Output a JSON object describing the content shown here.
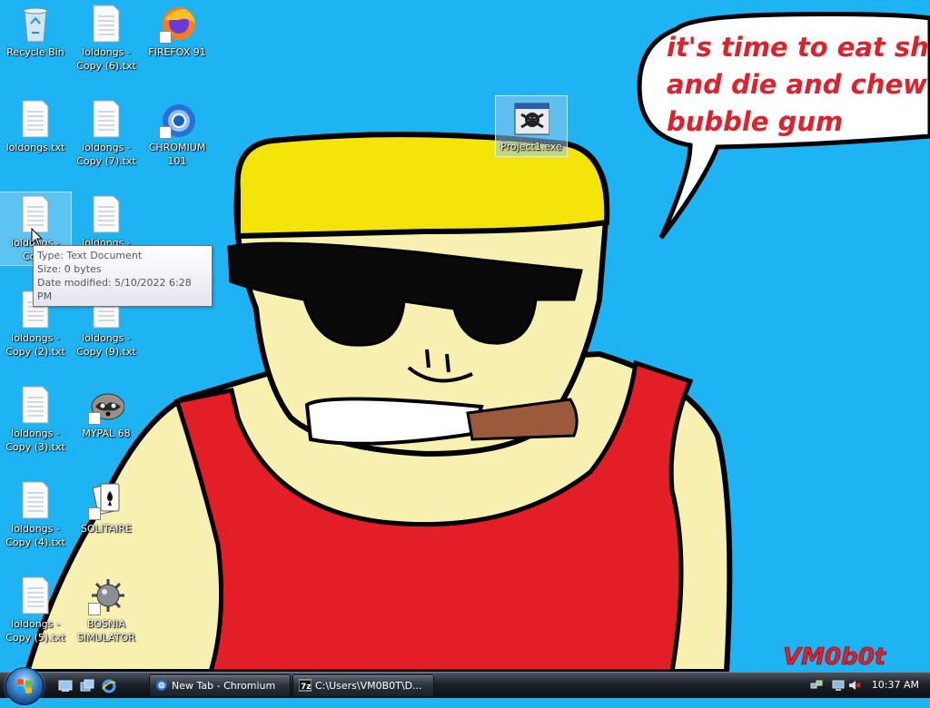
{
  "wallpaper": {
    "speech_line1": "it's time to eat shit",
    "speech_line2": "and die and chew",
    "speech_line3": "bubble gum",
    "signature": "VM0b0t",
    "colors": {
      "sky": "#1eb3f2",
      "text_red": "#e0202a",
      "hat": "#f4e40a",
      "shirt": "#e41e26",
      "skin": "#f7f0b0"
    }
  },
  "desktop_icons": [
    {
      "label": "Recycle Bin",
      "icon": "recycle-bin-icon"
    },
    {
      "label": "loldongs - Copy (6).txt",
      "icon": "text-file-icon"
    },
    {
      "label": "FIREFOX 91",
      "icon": "firefox-icon"
    },
    {
      "label": "loldongs.txt",
      "icon": "text-file-icon"
    },
    {
      "label": "loldongs - Copy (7).txt",
      "icon": "text-file-icon"
    },
    {
      "label": "CHROMIUM 101",
      "icon": "chromium-icon"
    },
    {
      "label": "loldongs - Copy",
      "icon": "text-file-icon"
    },
    {
      "label": "loldongs -",
      "icon": "text-file-icon"
    },
    {
      "label": "loldongs - Copy (2).txt",
      "icon": "text-file-icon"
    },
    {
      "label": "loldongs - Copy (9).txt",
      "icon": "text-file-icon"
    },
    {
      "label": "loldongs - Copy (3).txt",
      "icon": "text-file-icon"
    },
    {
      "label": "MYPAL 68",
      "icon": "raccoon-icon"
    },
    {
      "label": "loldongs - Copy (4).txt",
      "icon": "text-file-icon"
    },
    {
      "label": "SOLITAIRE",
      "icon": "solitaire-cards-icon"
    },
    {
      "label": "loldongs - Copy (5).txt",
      "icon": "text-file-icon"
    },
    {
      "label": "BOSNIA SIMULATOR",
      "icon": "mine-icon"
    },
    {
      "label": "Project1.exe",
      "icon": "skull-window-icon"
    }
  ],
  "tooltip": {
    "type": "Type: Text Document",
    "size": "Size: 0 bytes",
    "modified": "Date modified: 5/10/2022 6:28 PM"
  },
  "taskbar": {
    "start": "start-orb-icon",
    "quick_launch": [
      "show-desktop-icon",
      "switch-windows-icon",
      "internet-explorer-icon"
    ],
    "buttons": [
      {
        "label": "New Tab - Chromium",
        "icon": "chromium-icon"
      },
      {
        "label": "C:\\Users\\VM0B0T\\D...",
        "icon": "7zip-icon"
      }
    ],
    "tray_icons": [
      "network-icon",
      "display-icon",
      "volume-muted-icon"
    ],
    "clock": "10:37 AM"
  }
}
